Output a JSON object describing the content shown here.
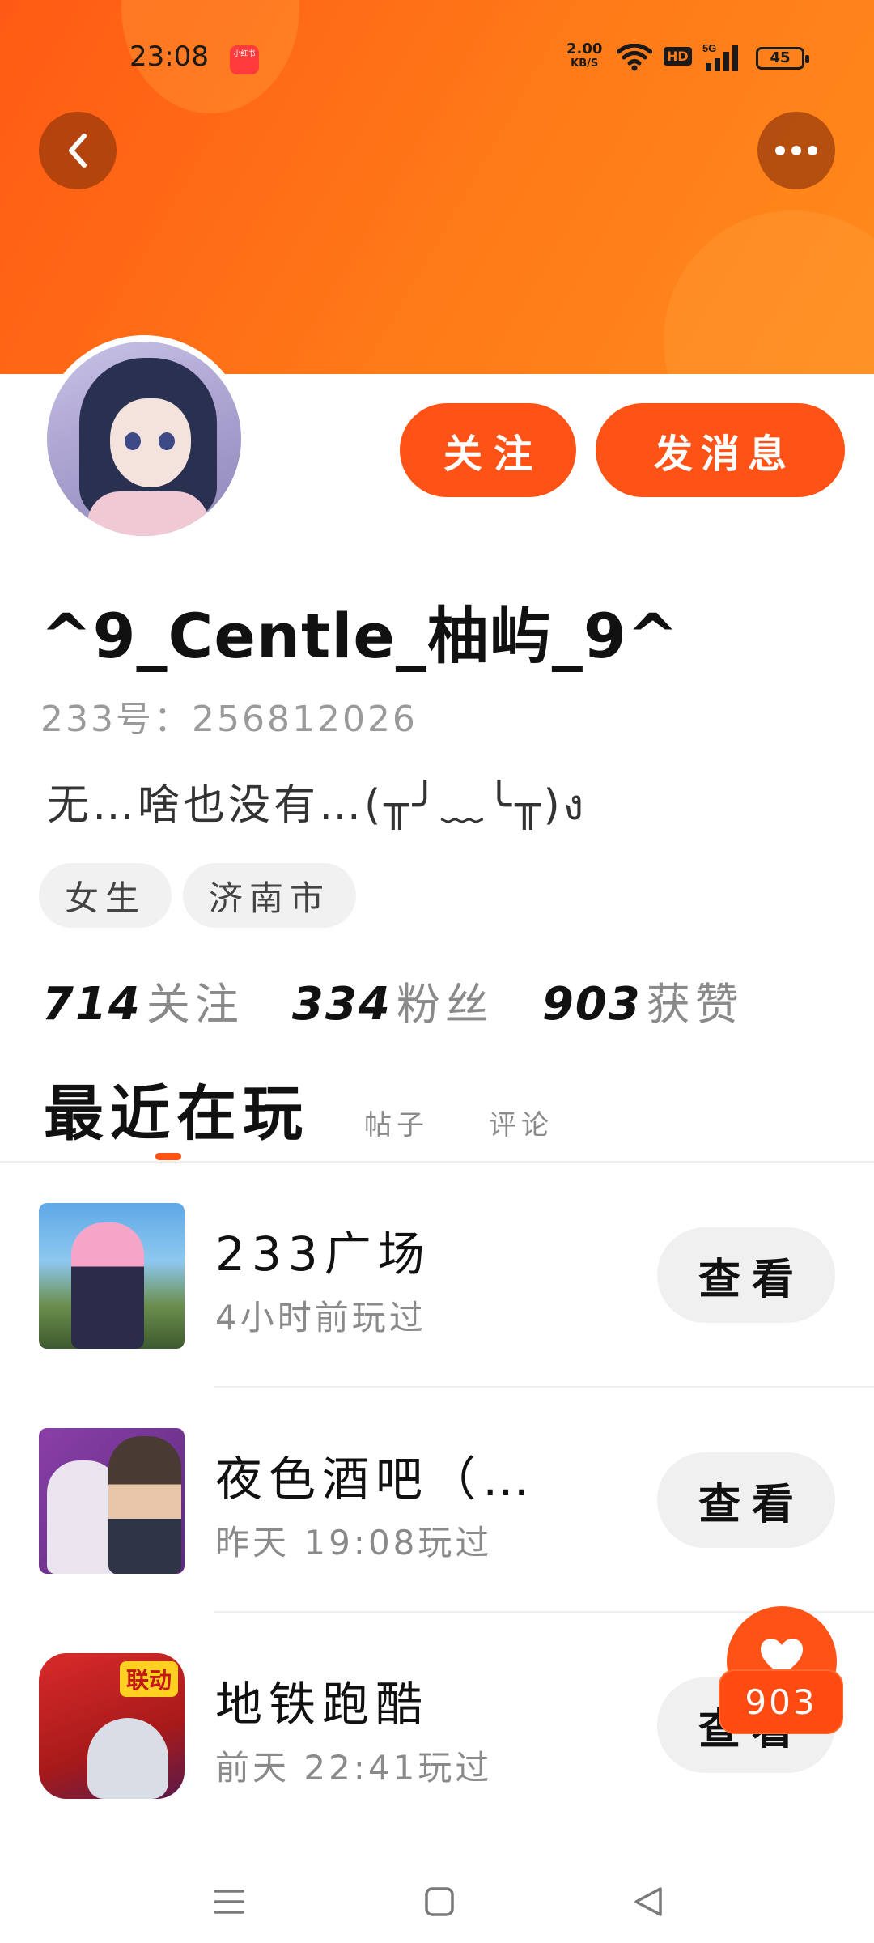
{
  "status_bar": {
    "time": "23:08",
    "app_badge": "小红书",
    "net_speed_value": "2.00",
    "net_speed_unit": "KB/S",
    "hd": "HD",
    "network": "5G",
    "battery": "45"
  },
  "colors": {
    "accent": "#ff5216",
    "header_gradient_start": "#ff5a14",
    "header_gradient_end": "#ff8a1c"
  },
  "profile": {
    "username": "^9_Centle_柚屿_9^",
    "user_id": "233号：256812026",
    "bio": "无…啥也没有…(╥╯﹏╰╥)ง",
    "tags": [
      "女生",
      "济南市"
    ],
    "follow_button": "关注",
    "message_button": "发消息"
  },
  "stats": {
    "following_count": "714",
    "following_label": "关注",
    "followers_count": "334",
    "followers_label": "粉丝",
    "likes_count": "903",
    "likes_label": "获赞"
  },
  "tabs": {
    "active": "最近在玩",
    "posts": "帖子",
    "comments": "评论"
  },
  "games": [
    {
      "title": "233广场",
      "subtitle": "4小时前玩过",
      "button": "查看",
      "icon": "game-233-plaza-icon"
    },
    {
      "title": "夜色酒吧（…",
      "subtitle": "昨天 19:08玩过",
      "button": "查看",
      "icon": "game-night-bar-icon"
    },
    {
      "title": "地铁跑酷",
      "subtitle": "前天 22:41玩过",
      "button": "查看",
      "icon": "game-subway-surfers-icon",
      "icon_badge": "联动"
    }
  ],
  "like_float": {
    "count": "903",
    "icon": "heart-icon"
  },
  "navbar": {
    "icons": [
      "menu-icon",
      "home-icon",
      "back-icon"
    ]
  }
}
